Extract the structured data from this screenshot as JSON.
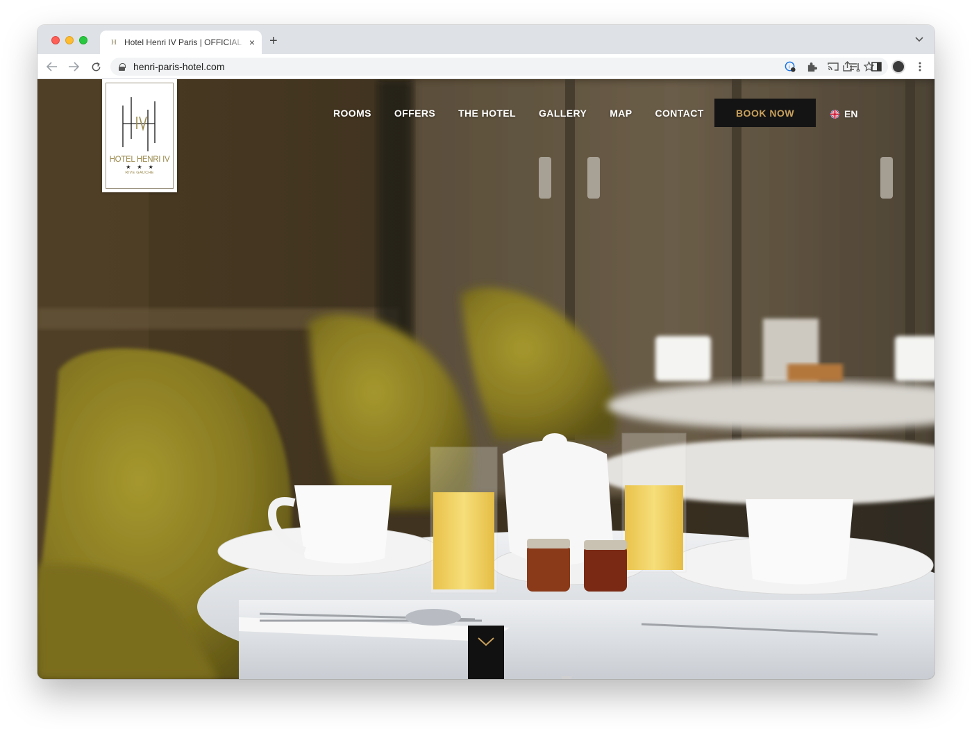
{
  "browser": {
    "tab_title": "Hotel Henri IV Paris | OFFICIAL",
    "tab_favicon": "H",
    "tab_close": "×",
    "new_tab": "+",
    "url": "henri-paris-hotel.com"
  },
  "site": {
    "logo": {
      "name": "HOTEL HENRI IV",
      "stars": "★★★",
      "subtitle": "RIVE GAUCHE"
    },
    "nav": [
      {
        "label": "ROOMS"
      },
      {
        "label": "OFFERS"
      },
      {
        "label": "THE HOTEL"
      },
      {
        "label": "GALLERY"
      },
      {
        "label": "MAP"
      },
      {
        "label": "CONTACT"
      }
    ],
    "book_label": "BOOK NOW",
    "language": "EN"
  },
  "colors": {
    "accent_gold": "#c9a15c",
    "logo_gold": "#9b8a4e",
    "book_bg": "#141414"
  }
}
